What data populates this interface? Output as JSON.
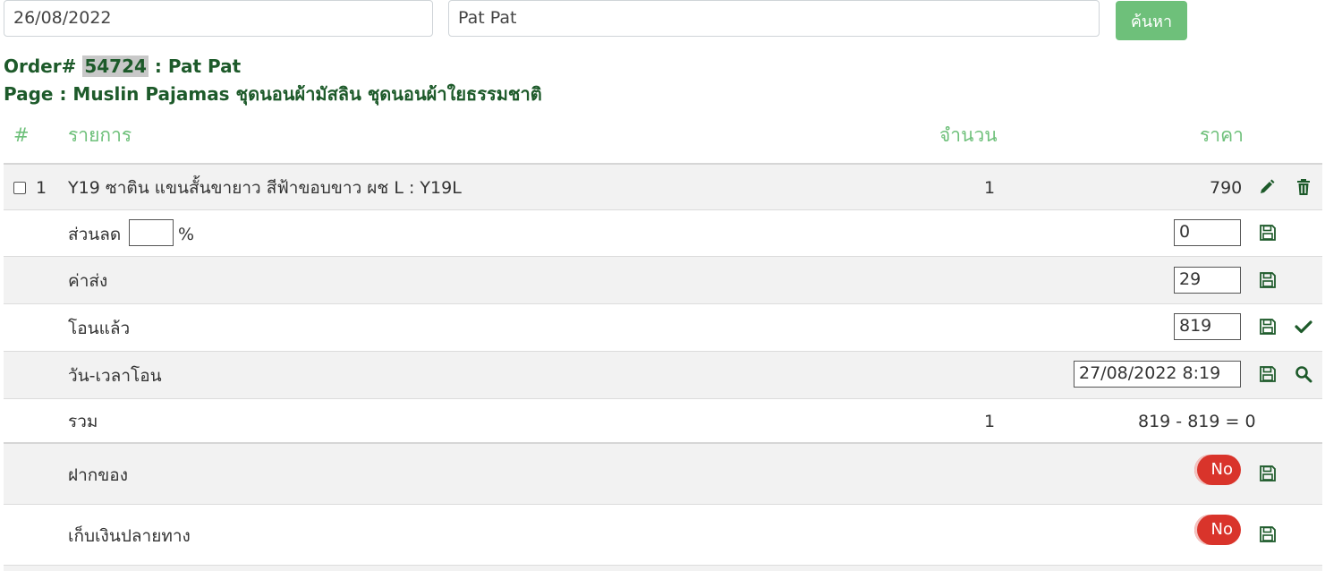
{
  "search": {
    "date_value": "26/08/2022",
    "name_value": "Pat Pat",
    "button_label": "ค้นหา"
  },
  "order": {
    "prefix": "Order#",
    "number": "54724",
    "customer": ": Pat Pat",
    "page_line": "Page : Muslin Pajamas ชุดนอนผ้ามัสลิน ชุดนอนผ้าใยธรรมชาติ"
  },
  "table": {
    "headers": {
      "index": "#",
      "item": "รายการ",
      "qty": "จำนวน",
      "price": "ราคา"
    },
    "items": [
      {
        "index": "1",
        "name": "Y19 ซาติน แขนสั้นขายาว สีฟ้าขอบขาว ผช L : Y19L",
        "qty": "1",
        "price": "790"
      }
    ],
    "discount": {
      "label": "ส่วนลด",
      "percent_value": "",
      "percent_sign": "%",
      "amount": "0"
    },
    "shipping": {
      "label": "ค่าส่ง",
      "amount": "29"
    },
    "transferred": {
      "label": "โอนแล้ว",
      "amount": "819"
    },
    "transfer_time": {
      "label": "วัน-เวลาโอน",
      "value": "27/08/2022 8:19"
    },
    "total": {
      "label": "รวม",
      "qty": "1",
      "formula": "819 - 819 = 0"
    },
    "deposit": {
      "label": "ฝากของ",
      "toggle": "No"
    },
    "cod": {
      "label": "เก็บเงินปลายทาง",
      "toggle": "No"
    }
  },
  "colors": {
    "accent_green": "#6ec07a",
    "dark_green": "#1d5a2a",
    "toggle_red": "#d9342b",
    "row_grey": "#f2f2f2"
  },
  "icons": [
    "pencil-icon",
    "trash-icon",
    "save-icon",
    "check-icon",
    "search-icon"
  ]
}
